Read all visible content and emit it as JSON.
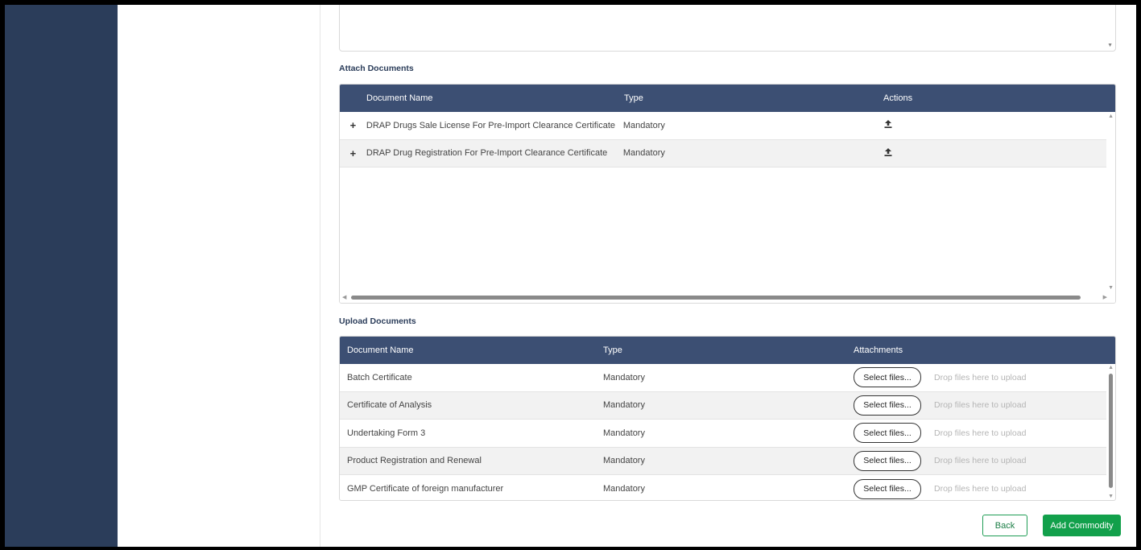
{
  "attach_documents": {
    "title": "Attach Documents",
    "columns": {
      "name": "Document Name",
      "type": "Type",
      "actions": "Actions"
    },
    "rows": [
      {
        "expand": "+",
        "name": "DRAP Drugs Sale License For Pre-Import Clearance Certificate",
        "type": "Mandatory",
        "action_icon": "upload-icon"
      },
      {
        "expand": "+",
        "name": "DRAP Drug Registration For Pre-Import Clearance Certificate",
        "type": "Mandatory",
        "action_icon": "upload-icon"
      }
    ]
  },
  "upload_documents": {
    "title": "Upload Documents",
    "columns": {
      "name": "Document Name",
      "type": "Type",
      "attachments": "Attachments"
    },
    "select_label": "Select files...",
    "drop_hint": "Drop files here to upload",
    "rows": [
      {
        "name": "Batch Certificate",
        "type": "Mandatory"
      },
      {
        "name": "Certificate of Analysis",
        "type": "Mandatory"
      },
      {
        "name": "Undertaking Form 3",
        "type": "Mandatory"
      },
      {
        "name": "Product Registration and Renewal",
        "type": "Mandatory"
      },
      {
        "name": "GMP Certificate of foreign manufacturer",
        "type": "Mandatory"
      }
    ]
  },
  "buttons": {
    "back": "Back",
    "add_commodity": "Add Commodity"
  },
  "colors": {
    "sidebar": "#2b3d5a",
    "grid_header": "#3c4f73",
    "primary_green": "#12a04b"
  }
}
